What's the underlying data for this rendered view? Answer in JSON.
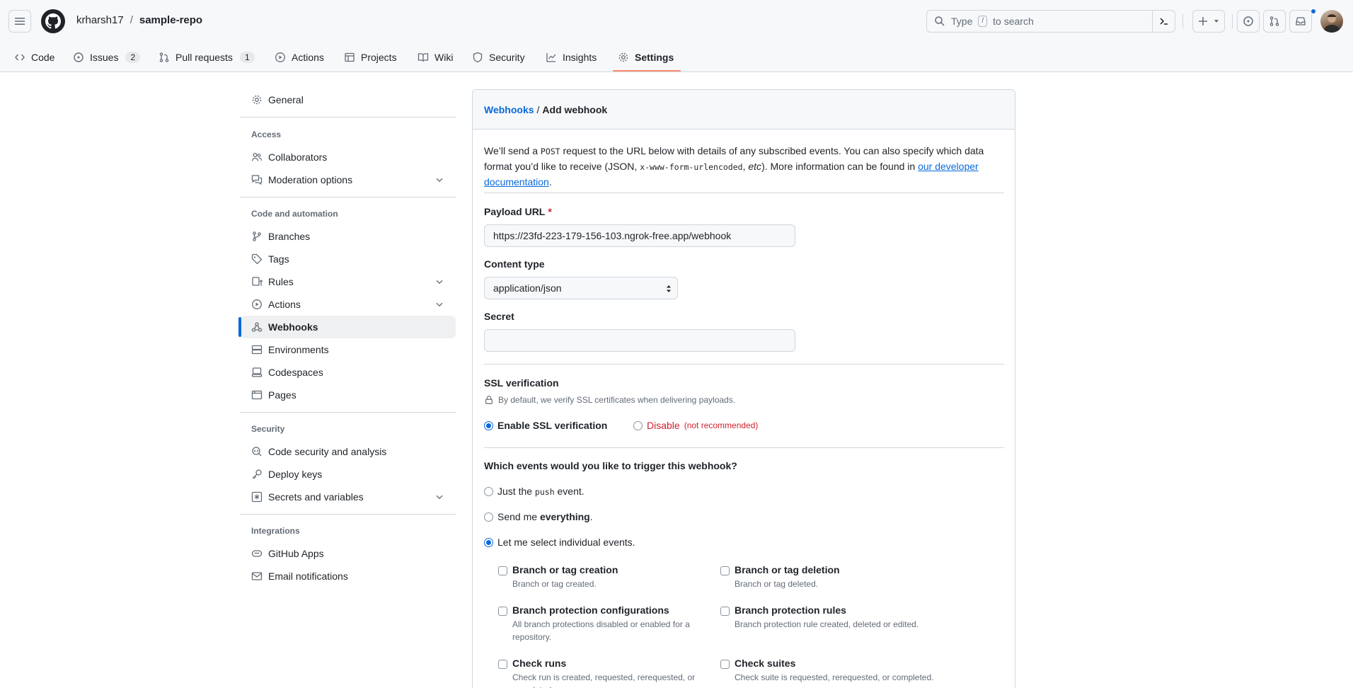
{
  "header": {
    "owner": "krharsh17",
    "separator": "/",
    "repo": "sample-repo",
    "search_text": "Type",
    "search_key": "/",
    "search_suffix": "to search"
  },
  "repo_nav": [
    {
      "label": "Code",
      "icon": "code-icon"
    },
    {
      "label": "Issues",
      "count": "2",
      "icon": "issue-opened-icon"
    },
    {
      "label": "Pull requests",
      "count": "1",
      "icon": "git-pull-request-icon"
    },
    {
      "label": "Actions",
      "icon": "play-icon"
    },
    {
      "label": "Projects",
      "icon": "table-icon"
    },
    {
      "label": "Wiki",
      "icon": "book-icon"
    },
    {
      "label": "Security",
      "icon": "shield-icon"
    },
    {
      "label": "Insights",
      "icon": "graph-icon"
    },
    {
      "label": "Settings",
      "icon": "gear-icon",
      "selected": true
    }
  ],
  "sidebar": {
    "general": "General",
    "sections": [
      {
        "heading": "Access",
        "items": [
          "Collaborators",
          "Moderation options"
        ]
      },
      {
        "heading": "Code and automation",
        "items": [
          "Branches",
          "Tags",
          "Rules",
          "Actions",
          "Webhooks",
          "Environments",
          "Codespaces",
          "Pages"
        ]
      },
      {
        "heading": "Security",
        "items": [
          "Code security and analysis",
          "Deploy keys",
          "Secrets and variables"
        ]
      },
      {
        "heading": "Integrations",
        "items": [
          "GitHub Apps",
          "Email notifications"
        ]
      }
    ],
    "active": "Webhooks"
  },
  "main": {
    "breadcrumb_link": "Webhooks",
    "breadcrumb_sep": "/",
    "breadcrumb_current": "Add webhook",
    "intro": {
      "p1": "We’ll send a ",
      "code1": "POST",
      "p2": " request to the URL below with details of any subscribed events. You can also specify which data format you’d like to receive (JSON, ",
      "code2": "x-www-form-urlencoded",
      "p3": ", ",
      "etc": "etc",
      "p4": "). More information can be found in ",
      "link": "our developer documentation",
      "p5": "."
    },
    "payload_label": "Payload URL",
    "required_mark": "*",
    "payload_value": "https://23fd-223-179-156-103.ngrok-free.app/webhook",
    "content_type_label": "Content type",
    "content_type_value": "application/json",
    "secret_label": "Secret",
    "secret_value": "",
    "ssl_label": "SSL verification",
    "ssl_note": "By default, we verify SSL certificates when delivering payloads.",
    "ssl_enable": "Enable SSL verification",
    "ssl_disable": "Disable",
    "ssl_disable_note": "(not recommended)",
    "events_question": "Which events would you like to trigger this webhook?",
    "opt_push_a": "Just the ",
    "opt_push_code": "push",
    "opt_push_b": " event.",
    "opt_all_a": "Send me ",
    "opt_all_b": "everything",
    "opt_all_c": ".",
    "opt_individual": "Let me select individual events.",
    "events": [
      {
        "title": "Branch or tag creation",
        "desc": "Branch or tag created."
      },
      {
        "title": "Branch or tag deletion",
        "desc": "Branch or tag deleted."
      },
      {
        "title": "Branch protection configurations",
        "desc": "All branch protections disabled or enabled for a repository."
      },
      {
        "title": "Branch protection rules",
        "desc": "Branch protection rule created, deleted or edited."
      },
      {
        "title": "Check runs",
        "desc": "Check run is created, requested, rerequested, or completed."
      },
      {
        "title": "Check suites",
        "desc": "Check suite is requested, rerequested, or completed."
      }
    ]
  }
}
